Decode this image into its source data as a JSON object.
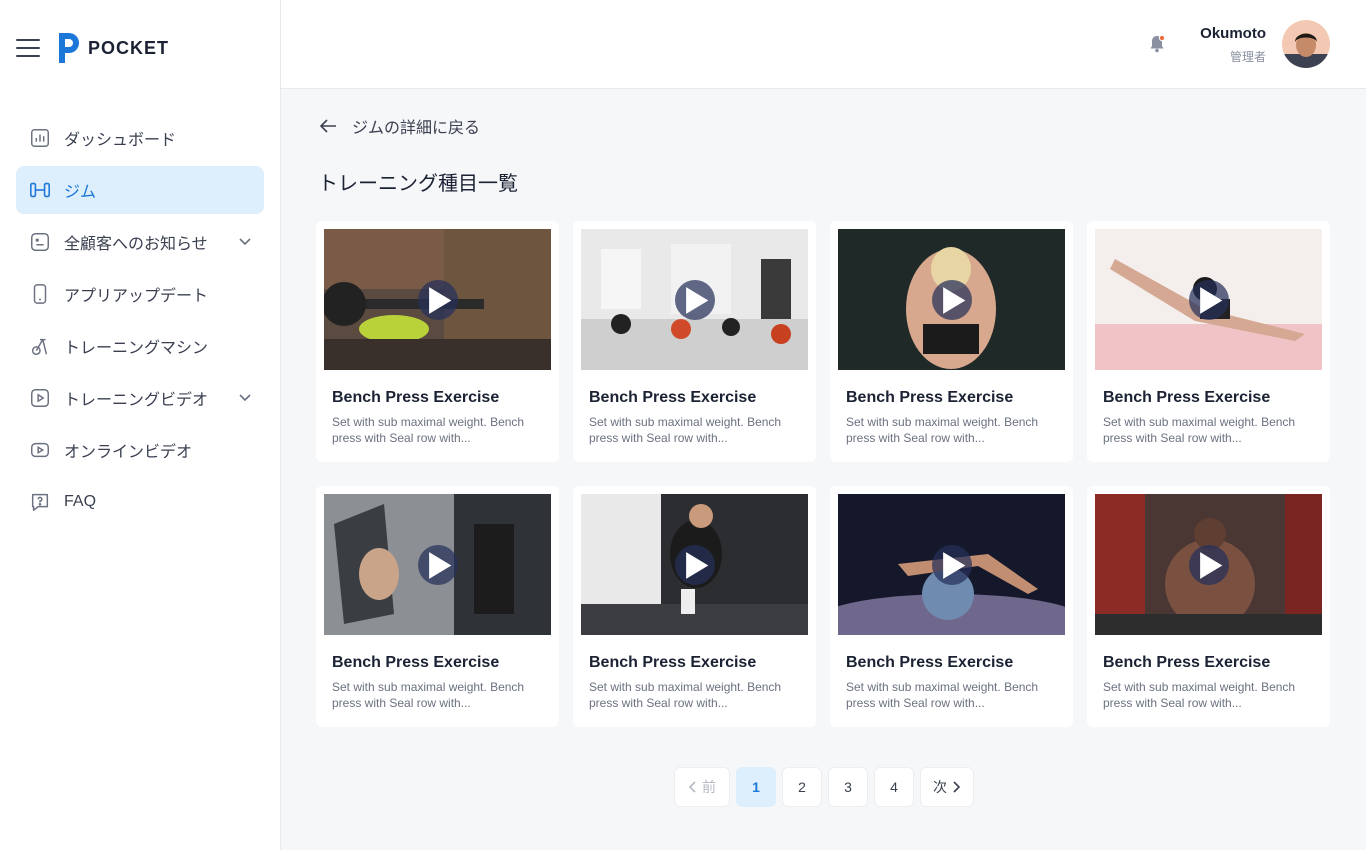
{
  "brand": {
    "name": "POCKET",
    "icon": "pocket-logo-icon"
  },
  "sidebar": {
    "items": [
      {
        "label": "ダッシュボード",
        "icon": "chart-icon",
        "active": false,
        "expandable": false
      },
      {
        "label": "ジム",
        "icon": "gym-icon",
        "active": true,
        "expandable": false
      },
      {
        "label": "全顧客へのお知らせ",
        "icon": "notice-icon",
        "active": false,
        "expandable": true
      },
      {
        "label": "アプリアップデート",
        "icon": "phone-icon",
        "active": false,
        "expandable": false
      },
      {
        "label": "トレーニングマシン",
        "icon": "bike-icon",
        "active": false,
        "expandable": false
      },
      {
        "label": "トレーニングビデオ",
        "icon": "video-icon",
        "active": false,
        "expandable": true
      },
      {
        "label": "オンラインビデオ",
        "icon": "video-icon",
        "active": false,
        "expandable": false
      },
      {
        "label": "FAQ",
        "icon": "question-icon",
        "active": false,
        "expandable": false
      }
    ]
  },
  "header": {
    "user_name": "Okumoto",
    "user_role": "管理者",
    "notification_dot_color": "#f26b3a"
  },
  "main": {
    "back_label": "ジムの詳細に戻る",
    "title": "トレーニング種目一覧",
    "cards": [
      {
        "title": "Bench Press Exercise",
        "desc": "Set with sub maximal weight. Bench press with Seal row with..."
      },
      {
        "title": "Bench Press Exercise",
        "desc": "Set with sub maximal weight. Bench press with Seal row with..."
      },
      {
        "title": "Bench Press Exercise",
        "desc": "Set with sub maximal weight. Bench press with Seal row with..."
      },
      {
        "title": "Bench Press Exercise",
        "desc": "Set with sub maximal weight. Bench press with Seal row with..."
      },
      {
        "title": "Bench Press Exercise",
        "desc": "Set with sub maximal weight. Bench press with Seal row with..."
      },
      {
        "title": "Bench Press Exercise",
        "desc": "Set with sub maximal weight. Bench press with Seal row with..."
      },
      {
        "title": "Bench Press Exercise",
        "desc": "Set with sub maximal weight. Bench press with Seal row with..."
      },
      {
        "title": "Bench Press Exercise",
        "desc": "Set with sub maximal weight. Bench press with Seal row with..."
      }
    ]
  },
  "pagination": {
    "prev_label": "前",
    "next_label": "次",
    "pages": [
      "1",
      "2",
      "3",
      "4"
    ],
    "current": "1"
  },
  "colors": {
    "accent": "#1c77d8",
    "active_bg": "#ddeefc"
  }
}
